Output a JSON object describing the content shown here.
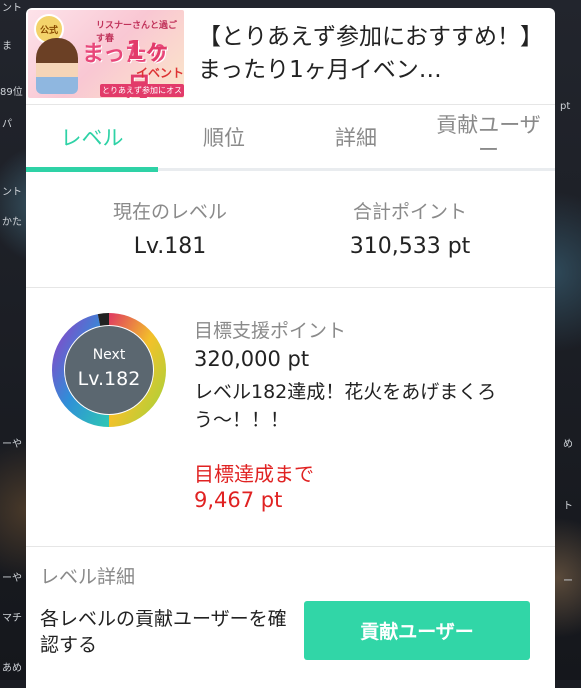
{
  "background_fragments": [
    "ント",
    "ま",
    "89位",
    "パ",
    "ント",
    "かた",
    "ーや",
    "ーや",
    "マチ",
    "あめ",
    "め",
    "ト",
    "pt",
    "ー"
  ],
  "header": {
    "title": "【とりあえず参加におすすめ！】まったり1ヶ月イベン…",
    "thumbnail": {
      "seal": "公式",
      "small_text": "リスナーさんと過ごす春",
      "big_text_1": "まったり",
      "big_text_2": "1ヶ月",
      "big_text_3": "イベント",
      "band": "とりあえず参加にオススメ"
    }
  },
  "tabs": [
    {
      "label": "レベル",
      "active": true
    },
    {
      "label": "順位",
      "active": false
    },
    {
      "label": "詳細",
      "active": false
    },
    {
      "label": "貢献ユーザー",
      "active": false
    }
  ],
  "stats": {
    "current_level_label": "現在のレベル",
    "current_level_value": "Lv.181",
    "total_points_label": "合計ポイント",
    "total_points_value": "310,533 pt"
  },
  "target": {
    "ring_next": "Next",
    "ring_level": "Lv.182",
    "label": "目標支援ポイント",
    "value": "320,000 pt",
    "message": "レベル182達成！花火をあげまくろう〜！！！",
    "remaining_label": "目標達成まで",
    "remaining_value": "9,467 pt",
    "progress": 0.97
  },
  "detail": {
    "title": "レベル詳細",
    "description": "各レベルの貢献ユーザーを確認する",
    "button": "貢献ユーザー"
  },
  "colors": {
    "accent": "#2ed2a6",
    "button": "#31d6a7",
    "alert": "#e02222",
    "muted": "#8a8a8a"
  }
}
